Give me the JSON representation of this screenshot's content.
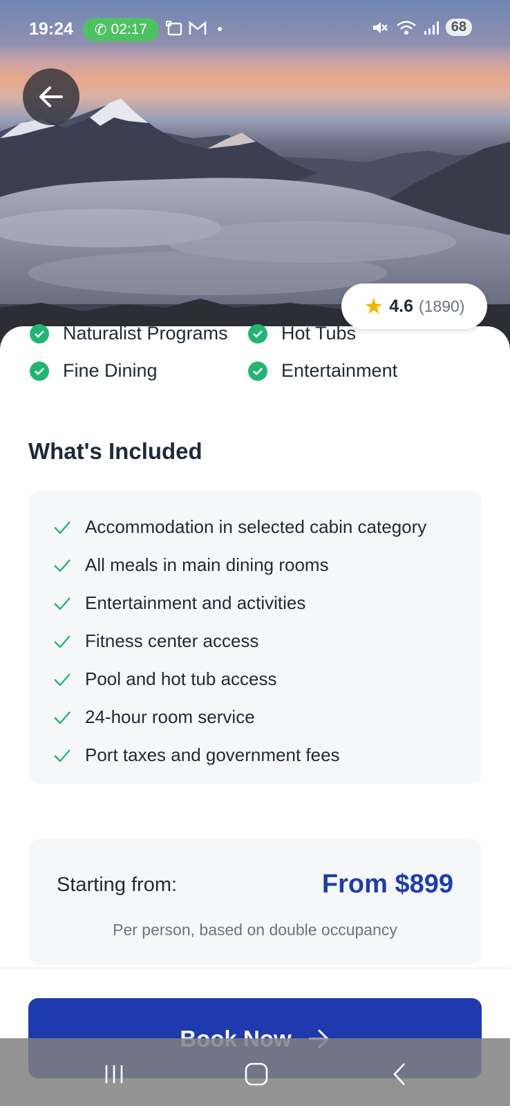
{
  "status_bar": {
    "time": "19:24",
    "call_timer": "02:17",
    "battery": "68"
  },
  "rating": {
    "value": "4.6",
    "count": "(1890)"
  },
  "amenities": [
    {
      "label": "Naturalist Programs"
    },
    {
      "label": "Hot Tubs"
    },
    {
      "label": "Fine Dining"
    },
    {
      "label": "Entertainment"
    }
  ],
  "included": {
    "title": "What's Included",
    "items": [
      "Accommodation in selected cabin category",
      "All meals in main dining rooms",
      "Entertainment and activities",
      "Fitness center access",
      "Pool and hot tub access",
      "24-hour room service",
      "Port taxes and government fees"
    ]
  },
  "pricing": {
    "label": "Starting from:",
    "value": "From $899",
    "note": "Per person, based on double occupancy"
  },
  "cta": {
    "label": "Book Now"
  },
  "colors": {
    "accent": "#1e3aad",
    "check": "#22b573",
    "price": "#1e3ea8"
  }
}
